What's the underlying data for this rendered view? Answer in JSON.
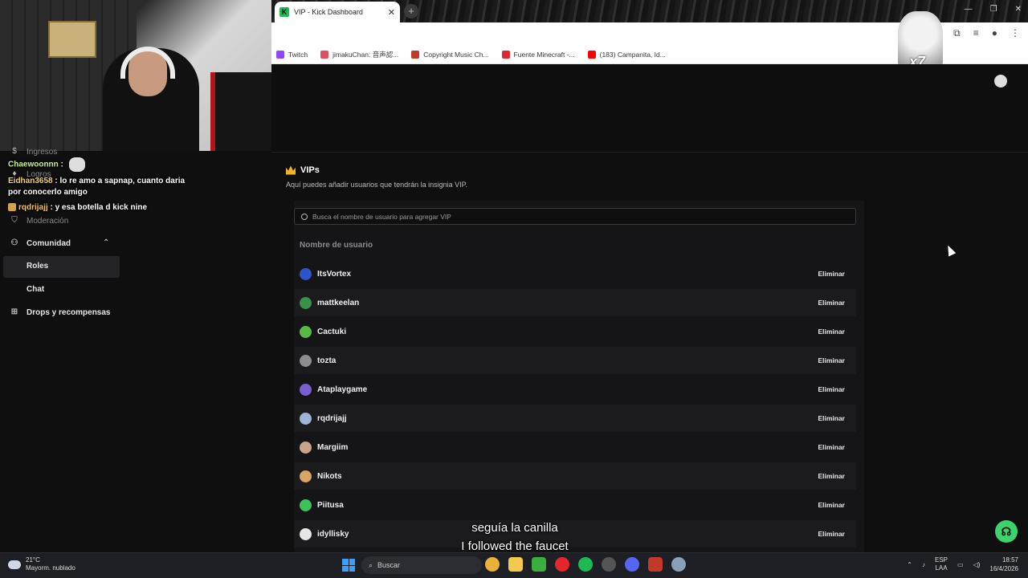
{
  "browser": {
    "tab_title": "VIP - Kick Dashboard",
    "tab_close": "✕",
    "new_tab": "+",
    "bookmarks": [
      {
        "label": "Twitch",
        "color": "#9146ff"
      },
      {
        "label": "jimakuChan: 音声認...",
        "color": "#e04f5f"
      },
      {
        "label": "Copyright Music Ch...",
        "color": "#c0392b"
      },
      {
        "label": "Fuente Minecraft -...",
        "color": "#e3262e"
      },
      {
        "label": "(183) Campanita, Id...",
        "color": "#ff0000"
      }
    ],
    "emote_overlay_text": "x7"
  },
  "chat": {
    "messages": [
      {
        "user": "Chaewoonnn",
        "text": ""
      },
      {
        "user": "Eidhan3658",
        "text": "lo re amo a sapnap, cuanto daria por conocerlo amigo"
      },
      {
        "user": "rqdrijajj",
        "text": "y esa botella d kick nine"
      }
    ]
  },
  "sidebar": {
    "faded_items": [
      "Ingresos",
      "Logros",
      "Moderación"
    ],
    "community_label": "Comunidad",
    "roles_label": "Roles",
    "chat_label": "Chat",
    "drops_label": "Drops y recompensas"
  },
  "main": {
    "title": "VIPs",
    "description": "Aquí puedes añadir usuarios que tendrán la insignia VIP.",
    "search_placeholder": "Busca el nombre de usuario para agregar VIP",
    "column_header": "Nombre de usuario",
    "remove_label": "Eliminar",
    "users": [
      {
        "name": "ItsVortex",
        "avatar_color": "#2f54c9"
      },
      {
        "name": "mattkeelan",
        "avatar_color": "#3a8f4a"
      },
      {
        "name": "Cactuki",
        "avatar_color": "#58b947"
      },
      {
        "name": "tozta",
        "avatar_color": "#8d8d8d"
      },
      {
        "name": "Ataplaygame",
        "avatar_color": "#7a5fd1"
      },
      {
        "name": "rqdrijajj",
        "avatar_color": "#9fb3d6"
      },
      {
        "name": "Margiim",
        "avatar_color": "#c9a38a"
      },
      {
        "name": "Nikots",
        "avatar_color": "#d8a468"
      },
      {
        "name": "Piitusa",
        "avatar_color": "#3cc15b"
      },
      {
        "name": "idyllisky",
        "avatar_color": "#e6e6e6"
      }
    ]
  },
  "subtitles": {
    "line1": "seguía la canilla",
    "line2": "I followed the faucet"
  },
  "taskbar": {
    "weather_temp": "21°C",
    "weather_desc": "Mayorm. nublado",
    "search_label": "Buscar",
    "lang_top": "ESP",
    "lang_bottom": "LAA",
    "time": "18:57",
    "date": "16/4/2026"
  }
}
